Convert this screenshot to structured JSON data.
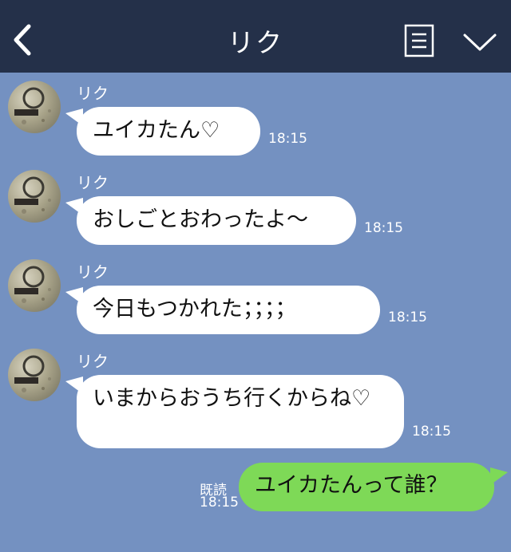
{
  "header": {
    "back_icon": "chevron-left-icon",
    "title": "リク",
    "menu_icon": "document-menu-icon",
    "collapse_icon": "chevron-down-icon"
  },
  "messages": [
    {
      "sender": "リク",
      "text": "ユイカたん♡",
      "time": "18:15"
    },
    {
      "sender": "リク",
      "text": "おしごとおわったよ〜",
      "time": "18:15"
    },
    {
      "sender": "リク",
      "text": "今日もつかれた；；；；",
      "time": "18:15"
    },
    {
      "sender": "リク",
      "text": "いまからおうち行くからね♡",
      "time": "18:15"
    }
  ],
  "my_message": {
    "text": "ユイカたんって誰？",
    "read_label": "既読",
    "time": "18:15"
  },
  "colors": {
    "header_bg": "#243049",
    "chat_bg": "#7491c1",
    "incoming_bubble": "#ffffff",
    "outgoing_bubble": "#7ed957"
  }
}
